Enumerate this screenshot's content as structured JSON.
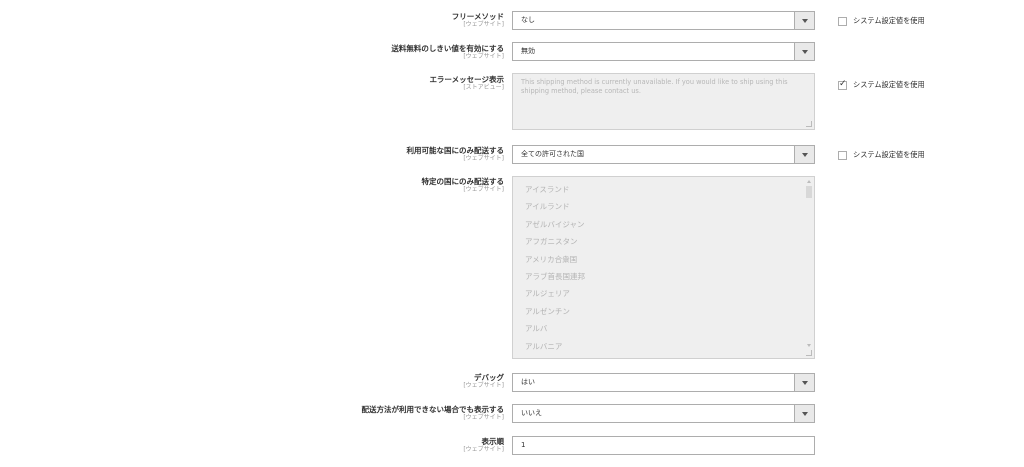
{
  "fields": {
    "free_method": {
      "label": "フリーメソッド",
      "scope": "[ウェブサイト]",
      "value": "なし"
    },
    "free_threshold": {
      "label": "送料無料のしきい値を有効にする",
      "scope": "[ウェブサイト]",
      "value": "無効"
    },
    "error_message": {
      "label": "エラーメッセージ表示",
      "scope": "[ストアビュー]",
      "value": "This shipping method is currently unavailable. If you would like to ship using this shipping method, please contact us."
    },
    "allowed_countries": {
      "label": "利用可能な国にのみ配送する",
      "scope": "[ウェブサイト]",
      "value": "全ての許可された国"
    },
    "specific_countries": {
      "label": "特定の国にのみ配送する",
      "scope": "[ウェブサイト]",
      "options": [
        "アイスランド",
        "アイルランド",
        "アゼルバイジャン",
        "アフガニスタン",
        "アメリカ合衆国",
        "アラブ首長国連邦",
        "アルジェリア",
        "アルゼンチン",
        "アルバ",
        "アルバニア"
      ]
    },
    "debug": {
      "label": "デバッグ",
      "scope": "[ウェブサイト]",
      "value": "はい"
    },
    "show_unavailable": {
      "label": "配送方法が利用できない場合でも表示する",
      "scope": "[ウェブサイト]",
      "value": "いいえ"
    },
    "sort_order": {
      "label": "表示順",
      "scope": "[ウェブサイト]",
      "value": "1"
    }
  },
  "system_default_label": "システム設定値を使用",
  "system_default": {
    "free_method": false,
    "error_message": true,
    "allowed_countries": false
  }
}
